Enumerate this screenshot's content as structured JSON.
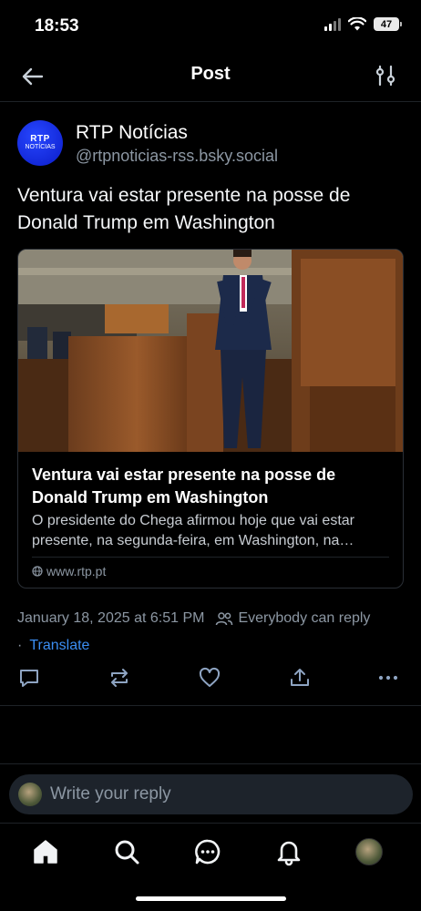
{
  "status_bar": {
    "time": "18:53",
    "battery": "47"
  },
  "header": {
    "title": "Post"
  },
  "post": {
    "author_name": "RTP Notícias",
    "author_handle": "@rtpnoticias-rss.bsky.social",
    "avatar_text_1": "RTP",
    "avatar_text_2": "NOTÍCIAS",
    "text": "Ventura vai estar presente na posse de Donald Trump em Washington",
    "card": {
      "title": "Ventura vai estar presente na posse de Donald Trump em Washington",
      "description": "O presidente do Chega afirmou hoje que vai estar presente, na segunda-feira, em Washington, na…",
      "domain": "www.rtp.pt"
    },
    "timestamp": "January 18, 2025 at 6:51 PM",
    "reply_setting": "Everybody can reply",
    "separator": "·",
    "translate_label": "Translate"
  },
  "reply_bar": {
    "placeholder": "Write your reply"
  },
  "icons": {
    "back": "arrow-left-icon",
    "filter": "sliders-icon",
    "reply": "speech-bubble-icon",
    "repost": "repost-icon",
    "like": "heart-icon",
    "share": "share-icon",
    "more": "ellipsis-icon",
    "home": "home-icon",
    "search": "search-icon",
    "chat": "chat-icon",
    "notifications": "bell-icon"
  },
  "colors": {
    "background": "#000000",
    "accent": "#3b8ef3",
    "muted": "#8c97a3"
  }
}
